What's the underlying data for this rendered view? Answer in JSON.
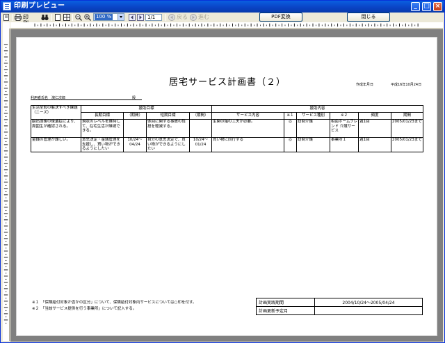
{
  "window": {
    "title": "印刷プレビュー"
  },
  "toolbar": {
    "print_label": "印刷..",
    "zoom_value": "100 %",
    "page_value": "1/1",
    "back_label": "戻る",
    "forward_label": "進む",
    "pdf_label": "PDF変換",
    "close_label": "閉じる"
  },
  "document": {
    "title": "居宅サービス計画書（２）",
    "created_label": "作成年月日",
    "created_value": "平成16年10月24日",
    "user_label": "利用者氏名",
    "user_name": "演仁次郎",
    "user_suffix": "殿",
    "headers": {
      "needs": "生活全般の解決すべき課題 （ニーズ）",
      "goals": "援助目標",
      "long_goal": "長期目標",
      "period1": "（期間）",
      "short_goal": "短期目標",
      "period2": "（期間）",
      "support": "援助内容",
      "service": "サービス内容",
      "mark1": "※１",
      "service_type": "サービス種別",
      "mark2": "※２",
      "frequency": "頻度",
      "period3": "期間"
    },
    "rows": [
      {
        "needs": "脳出血後の後遺症により、周囲生が確認される。",
        "long_goal": "現状のレベルを維持して、在宅生活が維続できる。",
        "long_period": "",
        "short_goal": "体回に関する事故の負担を軽減する。",
        "short_period": "",
        "service": "生関の諸の工夫が必要。",
        "mark1": "◎",
        "service_type": "訪問介護",
        "mark2": "相南ホームフレンド 介護サービス",
        "frequency": "週1回",
        "period": "2005/01/23まで"
      },
      {
        "needs": "金銭の管理が難しい。",
        "long_goal": "意思決定・金銭管理を支援し、買い物ができるようにしたい",
        "long_period": "10/24～ 04/24",
        "short_goal": "自分の意思決定で、買い物ができるようにしたい",
        "short_period": "10/24～ 01/24",
        "service": "買い物に同行する",
        "mark1": "◎",
        "service_type": "訪問介護",
        "mark2": "事業所１",
        "frequency": "週1回",
        "period": "2005/01/23まで"
      }
    ],
    "footnote1": "※１　「保険給付対象か否かの区分」について、保険給付対象内サービスについては○印を付す。",
    "footnote2": "※２　「当該サービス提供を行う事業所」について記入する。",
    "schedule": {
      "actual_label": "計画実践期間",
      "actual_value": "2004/10/24～2005/04/24",
      "update_label": "計画更新予定月",
      "update_value": ""
    }
  }
}
